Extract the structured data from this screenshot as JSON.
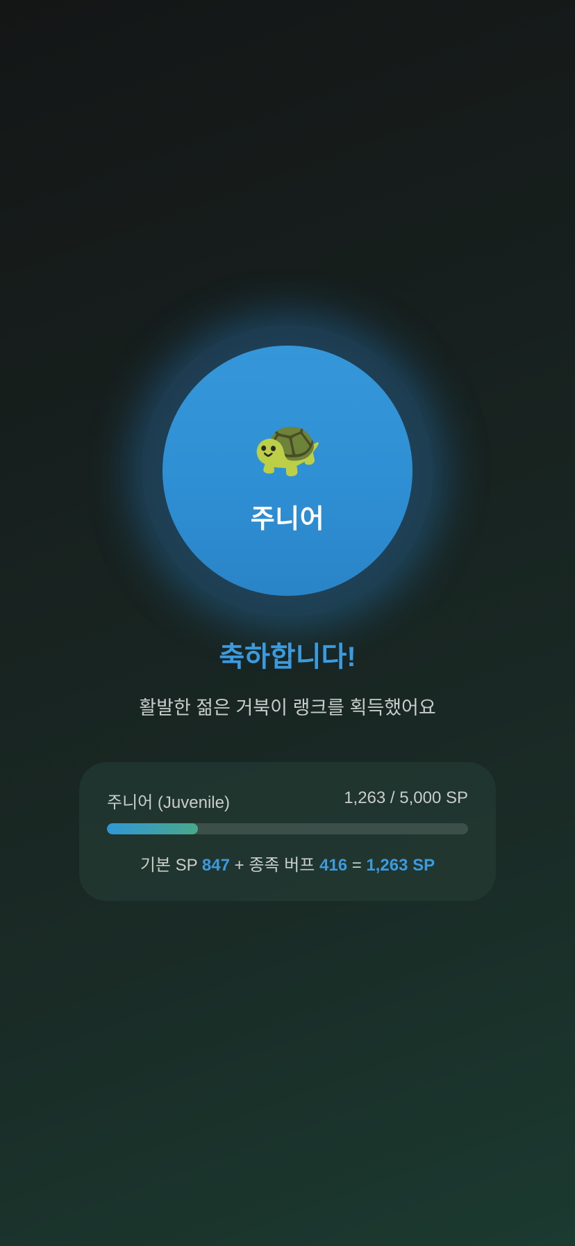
{
  "badge": {
    "icon": "turtle-icon",
    "icon_glyph": "🐢",
    "rank_name": "주니어"
  },
  "headline": "축하합니다!",
  "subtitle": "활발한 젊은 거북이 랭크를 획득했어요",
  "progress_card": {
    "rank_label": "주니어 (Juvenile)",
    "sp_status": "1,263 / 5,000 SP",
    "progress_fraction": 0.2526,
    "formula": {
      "base_label": "기본 SP",
      "base_value": "847",
      "plus1": "+",
      "buff_label": "종족 버프",
      "buff_value": "416",
      "equals": "=",
      "total": "1,263 SP"
    }
  },
  "colors": {
    "accent": "#3a9be0",
    "badge_inner": "#2f8fd4",
    "progress_start": "#3097d6",
    "progress_end": "#4aa88a"
  }
}
